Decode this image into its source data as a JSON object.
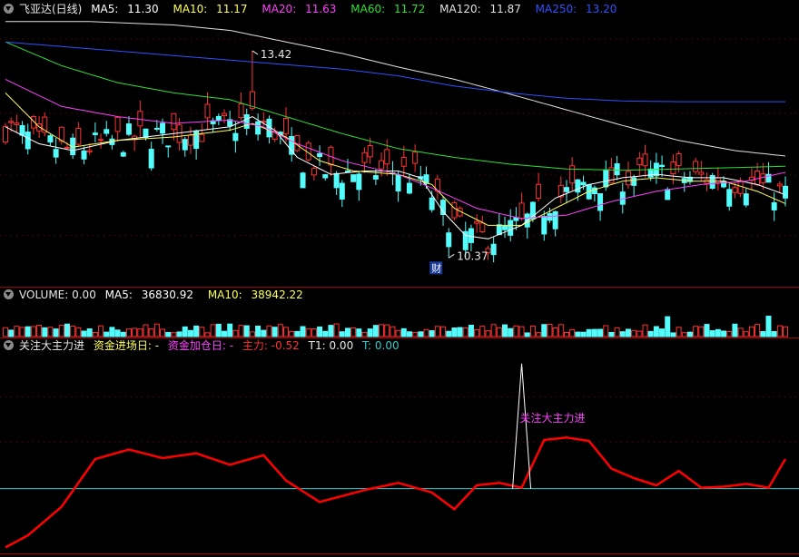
{
  "price_panel": {
    "stock": "飞亚达(日线)",
    "ma5": {
      "label": "MA5:",
      "value": "11.30",
      "color": "#ffffff"
    },
    "ma10": {
      "label": "MA10:",
      "value": "11.17",
      "color": "#ffff55"
    },
    "ma20": {
      "label": "MA20:",
      "value": "11.63",
      "color": "#ff40ff"
    },
    "ma60": {
      "label": "MA60:",
      "value": "11.72",
      "color": "#30e030"
    },
    "ma120": {
      "label": "MA120:",
      "value": "11.87",
      "color": "#e0e0e0"
    },
    "ma250": {
      "label": "MA250:",
      "value": "13.20",
      "color": "#3050ff"
    },
    "high_label": "13.42",
    "low_label": "10.37",
    "finance_badge": "财"
  },
  "volume_panel": {
    "title": "VOLUME: 0.00",
    "ma5": {
      "label": "MA5:",
      "value": "36830.92"
    },
    "ma10": {
      "label": "MA10:",
      "value": "38942.22"
    }
  },
  "indicator_panel": {
    "name": "关注大主力进",
    "f1_label": "资金进场日: -",
    "f2_label": "资金加仓日: -",
    "f3_label": "主力: -0.52",
    "f4_label": "T1: 0.00",
    "f5_label": "T: 0.00",
    "signal_label": "关注大主力进"
  },
  "colors": {
    "up": "#ff3232",
    "down": "#54fcfc",
    "grid": "#7a0000",
    "main": "#ff0000",
    "base": "#36c8c8"
  },
  "chart_data": {
    "type": "candlestick",
    "x_count": 140,
    "price_range": [
      10.0,
      13.9
    ],
    "high": {
      "index": 44,
      "value": 13.42
    },
    "low": {
      "index": 79,
      "value": 10.37
    },
    "series": [
      {
        "name": "MA5",
        "values": [
          [
            0,
            12.3
          ],
          [
            6,
            12.05
          ],
          [
            12,
            11.95
          ],
          [
            20,
            12.1
          ],
          [
            30,
            12.2
          ],
          [
            40,
            12.3
          ],
          [
            44,
            12.45
          ],
          [
            48,
            12.25
          ],
          [
            52,
            11.85
          ],
          [
            58,
            11.6
          ],
          [
            64,
            11.65
          ],
          [
            70,
            11.65
          ],
          [
            74,
            11.55
          ],
          [
            78,
            11.05
          ],
          [
            82,
            10.7
          ],
          [
            86,
            10.65
          ],
          [
            92,
            10.85
          ],
          [
            98,
            11.25
          ],
          [
            104,
            11.45
          ],
          [
            110,
            11.55
          ],
          [
            116,
            11.6
          ],
          [
            122,
            11.55
          ],
          [
            128,
            11.55
          ],
          [
            134,
            11.45
          ],
          [
            139,
            11.3
          ]
        ]
      },
      {
        "name": "MA10",
        "values": [
          [
            0,
            12.8
          ],
          [
            6,
            12.3
          ],
          [
            12,
            12.0
          ],
          [
            20,
            12.1
          ],
          [
            30,
            12.15
          ],
          [
            40,
            12.25
          ],
          [
            44,
            12.35
          ],
          [
            50,
            12.15
          ],
          [
            56,
            11.8
          ],
          [
            62,
            11.65
          ],
          [
            70,
            11.6
          ],
          [
            76,
            11.45
          ],
          [
            80,
            11.1
          ],
          [
            86,
            10.85
          ],
          [
            92,
            10.85
          ],
          [
            98,
            11.1
          ],
          [
            104,
            11.35
          ],
          [
            110,
            11.5
          ],
          [
            116,
            11.55
          ],
          [
            122,
            11.5
          ],
          [
            128,
            11.5
          ],
          [
            134,
            11.35
          ],
          [
            139,
            11.17
          ]
        ]
      },
      {
        "name": "MA20",
        "values": [
          [
            0,
            13.0
          ],
          [
            10,
            12.6
          ],
          [
            20,
            12.45
          ],
          [
            30,
            12.35
          ],
          [
            40,
            12.4
          ],
          [
            46,
            12.3
          ],
          [
            52,
            12.05
          ],
          [
            60,
            11.8
          ],
          [
            70,
            11.6
          ],
          [
            76,
            11.4
          ],
          [
            84,
            11.1
          ],
          [
            92,
            10.95
          ],
          [
            100,
            11.0
          ],
          [
            108,
            11.2
          ],
          [
            116,
            11.35
          ],
          [
            124,
            11.45
          ],
          [
            132,
            11.5
          ],
          [
            139,
            11.63
          ]
        ]
      },
      {
        "name": "MA60",
        "values": [
          [
            0,
            13.55
          ],
          [
            10,
            13.2
          ],
          [
            20,
            12.95
          ],
          [
            30,
            12.8
          ],
          [
            40,
            12.7
          ],
          [
            50,
            12.45
          ],
          [
            60,
            12.2
          ],
          [
            70,
            11.98
          ],
          [
            80,
            11.85
          ],
          [
            90,
            11.75
          ],
          [
            100,
            11.68
          ],
          [
            110,
            11.66
          ],
          [
            120,
            11.68
          ],
          [
            130,
            11.7
          ],
          [
            139,
            11.72
          ]
        ]
      },
      {
        "name": "MA120",
        "values": [
          [
            0,
            13.85
          ],
          [
            15,
            13.85
          ],
          [
            30,
            13.8
          ],
          [
            40,
            13.72
          ],
          [
            50,
            13.55
          ],
          [
            60,
            13.38
          ],
          [
            70,
            13.18
          ],
          [
            80,
            13.0
          ],
          [
            90,
            12.78
          ],
          [
            100,
            12.55
          ],
          [
            110,
            12.32
          ],
          [
            120,
            12.1
          ],
          [
            130,
            11.95
          ],
          [
            139,
            11.87
          ]
        ]
      },
      {
        "name": "MA250",
        "values": [
          [
            0,
            13.55
          ],
          [
            15,
            13.45
          ],
          [
            30,
            13.35
          ],
          [
            45,
            13.25
          ],
          [
            60,
            13.15
          ],
          [
            70,
            13.05
          ],
          [
            80,
            12.9
          ],
          [
            90,
            12.8
          ],
          [
            100,
            12.72
          ],
          [
            110,
            12.68
          ],
          [
            120,
            12.67
          ],
          [
            139,
            12.67
          ]
        ]
      }
    ],
    "indicator": {
      "range": [
        -1.8,
        2.4
      ],
      "baseline": -0.52,
      "values": [
        [
          0,
          -1.75
        ],
        [
          4,
          -1.5
        ],
        [
          10,
          -0.9
        ],
        [
          16,
          0.1
        ],
        [
          22,
          0.3
        ],
        [
          28,
          0.12
        ],
        [
          34,
          0.22
        ],
        [
          40,
          -0.02
        ],
        [
          46,
          0.18
        ],
        [
          50,
          -0.35
        ],
        [
          56,
          -0.8
        ],
        [
          64,
          -0.55
        ],
        [
          70,
          -0.4
        ],
        [
          76,
          -0.6
        ],
        [
          80,
          -0.95
        ],
        [
          84,
          -0.45
        ],
        [
          88,
          -0.4
        ],
        [
          92,
          -0.5
        ],
        [
          96,
          0.5
        ],
        [
          100,
          0.55
        ],
        [
          104,
          0.48
        ],
        [
          108,
          -0.1
        ],
        [
          112,
          -0.3
        ],
        [
          116,
          -0.45
        ],
        [
          120,
          -0.15
        ],
        [
          124,
          -0.5
        ],
        [
          128,
          -0.48
        ],
        [
          132,
          -0.42
        ],
        [
          136,
          -0.5
        ],
        [
          139,
          0.1
        ]
      ],
      "signal": {
        "index": 92,
        "peak": 2.1
      }
    }
  }
}
